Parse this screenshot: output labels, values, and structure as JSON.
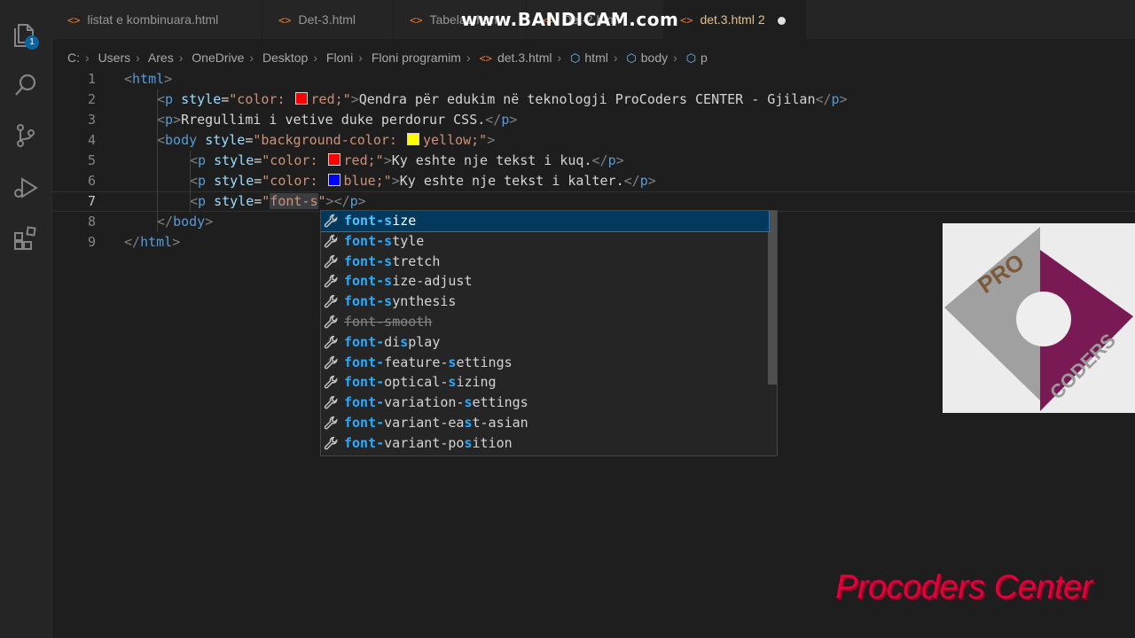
{
  "activity_bar": {
    "explorer_badge": "1"
  },
  "tabs": [
    {
      "label": "listat e kombinuara.html"
    },
    {
      "label": "Det-3.html"
    },
    {
      "label": "Tabela1.html"
    },
    {
      "label": "Det-2.html"
    },
    {
      "label": "det.3.html 2",
      "active": true,
      "modified": true
    }
  ],
  "watermark": "www.BANDICAM.com",
  "breadcrumb": [
    "C:",
    "Users",
    "Ares",
    "OneDrive",
    "Desktop",
    "Floni",
    "Floni programim",
    "det.3.html",
    "html",
    "body",
    "p"
  ],
  "editor": {
    "current_line": 7,
    "lines": [
      {
        "n": "1",
        "segs": [
          [
            "t",
            "<"
          ],
          [
            "tg",
            "html"
          ],
          [
            "t",
            ">"
          ]
        ]
      },
      {
        "n": "2",
        "segs": [
          [
            "t",
            "<"
          ],
          [
            "tg",
            "p"
          ],
          [
            "tx",
            " "
          ],
          [
            "at",
            "style"
          ],
          [
            "tx",
            "="
          ],
          [
            "st",
            "\"color: "
          ],
          [
            "sw",
            "#ff0000"
          ],
          [
            "st",
            "red;\""
          ],
          [
            "t",
            ">"
          ],
          [
            "tx",
            "Qendra për edukim në teknologji ProCoders CENTER - Gjilan"
          ],
          [
            "t",
            "</"
          ],
          [
            "tg",
            "p"
          ],
          [
            "t",
            ">"
          ]
        ]
      },
      {
        "n": "3",
        "segs": [
          [
            "t",
            "<"
          ],
          [
            "tg",
            "p"
          ],
          [
            "t",
            ">"
          ],
          [
            "tx",
            "Rregullimi i vetive duke perdorur CSS."
          ],
          [
            "t",
            "</"
          ],
          [
            "tg",
            "p"
          ],
          [
            "t",
            ">"
          ]
        ]
      },
      {
        "n": "4",
        "segs": [
          [
            "t",
            "<"
          ],
          [
            "tg",
            "body"
          ],
          [
            "tx",
            " "
          ],
          [
            "at",
            "style"
          ],
          [
            "tx",
            "="
          ],
          [
            "st",
            "\"background-color: "
          ],
          [
            "sw",
            "#ffff00"
          ],
          [
            "st",
            "yellow;\""
          ],
          [
            "t",
            ">"
          ]
        ]
      },
      {
        "n": "5",
        "segs": [
          [
            "t",
            "<"
          ],
          [
            "tg",
            "p"
          ],
          [
            "tx",
            " "
          ],
          [
            "at",
            "style"
          ],
          [
            "tx",
            "="
          ],
          [
            "st",
            "\"color: "
          ],
          [
            "sw",
            "#ff0000"
          ],
          [
            "st",
            "red;\""
          ],
          [
            "t",
            ">"
          ],
          [
            "tx",
            "Ky eshte nje tekst i kuq."
          ],
          [
            "t",
            "</"
          ],
          [
            "tg",
            "p"
          ],
          [
            "t",
            ">"
          ]
        ]
      },
      {
        "n": "6",
        "segs": [
          [
            "t",
            "<"
          ],
          [
            "tg",
            "p"
          ],
          [
            "tx",
            " "
          ],
          [
            "at",
            "style"
          ],
          [
            "tx",
            "="
          ],
          [
            "st",
            "\"color: "
          ],
          [
            "sw",
            "#0000ff"
          ],
          [
            "st",
            "blue;\""
          ],
          [
            "t",
            ">"
          ],
          [
            "tx",
            "Ky eshte nje tekst i kalter."
          ],
          [
            "t",
            "</"
          ],
          [
            "tg",
            "p"
          ],
          [
            "t",
            ">"
          ]
        ]
      },
      {
        "n": "7",
        "segs": [
          [
            "t",
            "<"
          ],
          [
            "tg",
            "p"
          ],
          [
            "tx",
            " "
          ],
          [
            "at",
            "style"
          ],
          [
            "tx",
            "="
          ],
          [
            "st",
            "\""
          ],
          [
            "hl",
            "font-s"
          ],
          [
            "st",
            "\""
          ],
          [
            "t",
            ">"
          ],
          [
            "t",
            "</"
          ],
          [
            "tg",
            "p"
          ],
          [
            "t",
            ">"
          ]
        ]
      },
      {
        "n": "8",
        "segs": [
          [
            "t",
            "</"
          ],
          [
            "tg",
            "body"
          ],
          [
            "t",
            ">"
          ]
        ]
      },
      {
        "n": "9",
        "segs": [
          [
            "t",
            "</"
          ],
          [
            "tg",
            "html"
          ],
          [
            "t",
            ">"
          ]
        ]
      }
    ]
  },
  "suggestions": [
    {
      "parts": [
        [
          "m",
          "font-s"
        ],
        [
          "p",
          "ize"
        ]
      ],
      "selected": true
    },
    {
      "parts": [
        [
          "m",
          "font-s"
        ],
        [
          "p",
          "tyle"
        ]
      ]
    },
    {
      "parts": [
        [
          "m",
          "font-s"
        ],
        [
          "p",
          "tretch"
        ]
      ]
    },
    {
      "parts": [
        [
          "m",
          "font-s"
        ],
        [
          "p",
          "ize-adjust"
        ]
      ]
    },
    {
      "parts": [
        [
          "m",
          "font-s"
        ],
        [
          "p",
          "ynthesis"
        ]
      ]
    },
    {
      "parts": [
        [
          "m",
          "font-s"
        ],
        [
          "p",
          "mooth"
        ]
      ],
      "deprecated": true
    },
    {
      "parts": [
        [
          "m",
          "font-"
        ],
        [
          "p",
          "di"
        ],
        [
          "m",
          "s"
        ],
        [
          "p",
          "play"
        ]
      ]
    },
    {
      "parts": [
        [
          "m",
          "font-"
        ],
        [
          "p",
          "feature-"
        ],
        [
          "m",
          "s"
        ],
        [
          "p",
          "ettings"
        ]
      ]
    },
    {
      "parts": [
        [
          "m",
          "font-"
        ],
        [
          "p",
          "optical-"
        ],
        [
          "m",
          "s"
        ],
        [
          "p",
          "izing"
        ]
      ]
    },
    {
      "parts": [
        [
          "m",
          "font-"
        ],
        [
          "p",
          "variation-"
        ],
        [
          "m",
          "s"
        ],
        [
          "p",
          "ettings"
        ]
      ]
    },
    {
      "parts": [
        [
          "m",
          "font-"
        ],
        [
          "p",
          "variant-ea"
        ],
        [
          "m",
          "s"
        ],
        [
          "p",
          "t-asian"
        ]
      ]
    },
    {
      "parts": [
        [
          "m",
          "font-"
        ],
        [
          "p",
          "variant-po"
        ],
        [
          "m",
          "s"
        ],
        [
          "p",
          "ition"
        ]
      ]
    }
  ],
  "logo": {
    "text_top": "PRO",
    "text_side": "CODERS",
    "colors": {
      "gray": "#9a9a9a",
      "purple": "#7a1a55",
      "circle": "#eeeeee"
    }
  },
  "brand": "Procoders Center"
}
